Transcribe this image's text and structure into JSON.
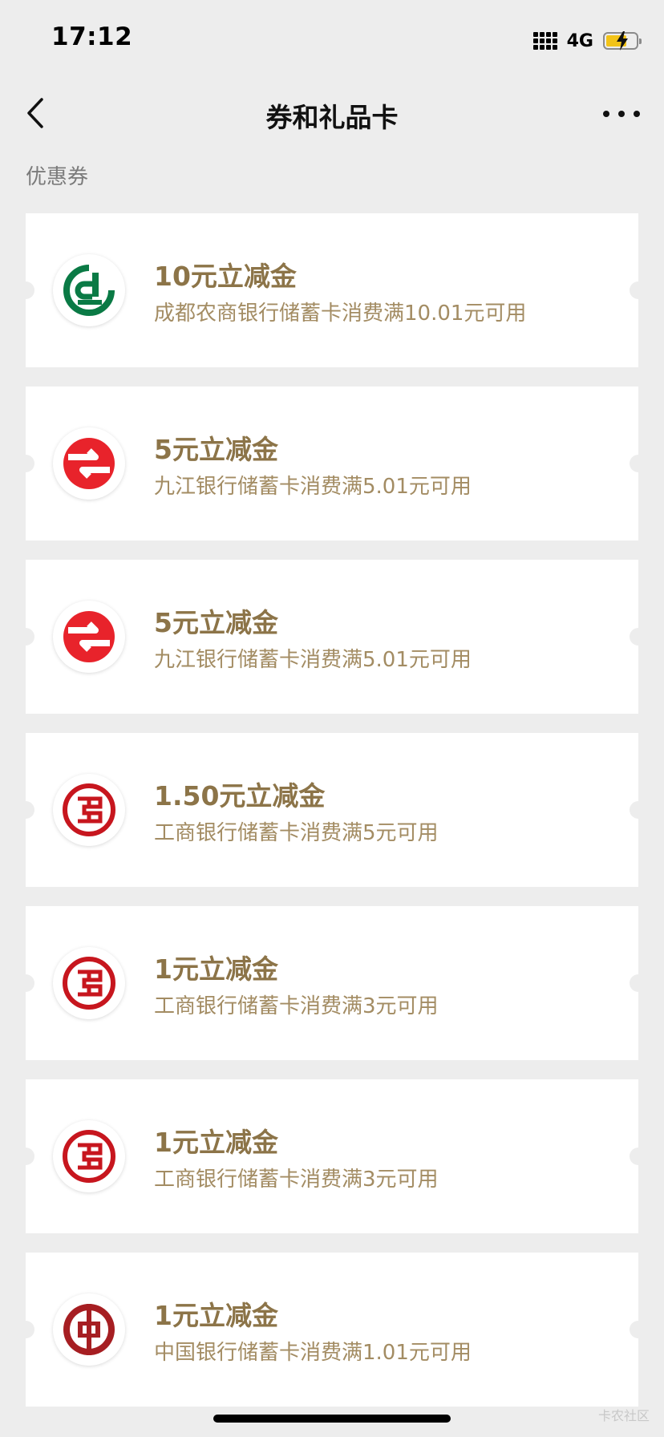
{
  "status": {
    "time": "17:12",
    "network": "4G",
    "battery_color": "#f2c318"
  },
  "nav": {
    "title": "券和礼品卡",
    "back_icon": "chevron-left-icon",
    "more_icon": "more-dots-icon"
  },
  "section": {
    "label": "优惠券"
  },
  "coupons": [
    {
      "title": "10元立减金",
      "desc": "成都农商银行储蓄卡消费满10.01元可用",
      "logo": "chengdu-rural-bank-logo"
    },
    {
      "title": "5元立减金",
      "desc": "九江银行储蓄卡消费满5.01元可用",
      "logo": "jiujiang-bank-logo"
    },
    {
      "title": "5元立减金",
      "desc": "九江银行储蓄卡消费满5.01元可用",
      "logo": "jiujiang-bank-logo"
    },
    {
      "title": "1.50元立减金",
      "desc": "工商银行储蓄卡消费满5元可用",
      "logo": "icbc-logo"
    },
    {
      "title": "1元立减金",
      "desc": "工商银行储蓄卡消费满3元可用",
      "logo": "icbc-logo"
    },
    {
      "title": "1元立减金",
      "desc": "工商银行储蓄卡消费满3元可用",
      "logo": "icbc-logo"
    },
    {
      "title": "1元立减金",
      "desc": "中国银行储蓄卡消费满1.01元可用",
      "logo": "boc-logo"
    }
  ],
  "watermark": "卡农社区",
  "colors": {
    "background": "#ededed",
    "coupon_title": "#8c7448",
    "coupon_desc": "#a38c63",
    "chengdu_green": "#0a7a45",
    "jiujiang_red": "#e8232b",
    "icbc_red": "#c7161e",
    "boc_red": "#a61e22"
  }
}
